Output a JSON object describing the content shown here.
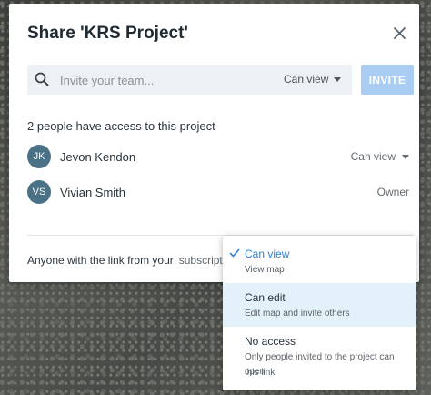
{
  "dialog": {
    "title": "Share 'KRS Project'",
    "invite": {
      "placeholder": "Invite your team...",
      "permission": "Can view",
      "button_label": "INVITE"
    },
    "access_count_text": "2 people have access to this project",
    "people": [
      {
        "initials": "JK",
        "name": "Jevon Kendon",
        "role": "Can view",
        "has_dropdown": true
      },
      {
        "initials": "VS",
        "name": "Vivian Smith",
        "role": "Owner",
        "has_dropdown": false
      }
    ],
    "link_sharing": {
      "text": "Anyone with the link from your",
      "scope": "subscription"
    }
  },
  "dropdown": {
    "options": [
      {
        "label": "Can view",
        "description": "View map",
        "selected": true
      },
      {
        "label": "Can edit",
        "description": "Edit map and invite others",
        "highlighted": true
      },
      {
        "label": "No access",
        "description_line1": "Only people invited to the project can open",
        "description_line2": "this link"
      }
    ]
  },
  "colors": {
    "accent": "#2f80d0",
    "invite_button": "#a9cdf3",
    "avatar": "#4a7186",
    "highlight": "#e3f1fa"
  }
}
